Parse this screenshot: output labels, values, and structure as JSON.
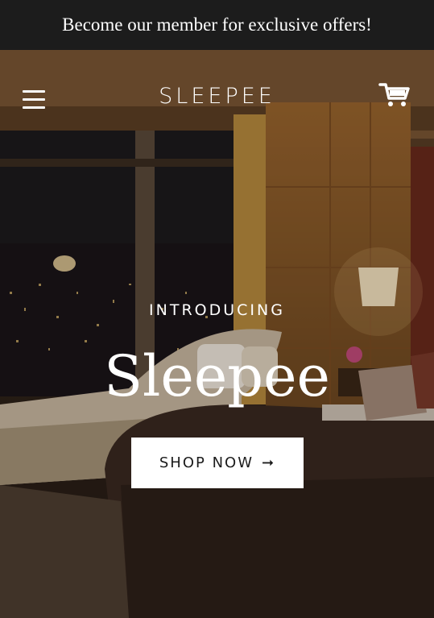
{
  "announcement": {
    "text": "Become our member for exclusive offers!"
  },
  "header": {
    "logo": "SLEEPEE",
    "menu_icon": "hamburger-menu-icon",
    "cart_icon": "shopping-cart-icon"
  },
  "hero": {
    "eyebrow": "INTRODUCING",
    "headline": "Sleepee",
    "cta_label": "SHOP NOW",
    "cta_icon": "arrow-right-icon",
    "cta_arrow": "➞"
  },
  "colors": {
    "announcement_bg": "#1c1c1c",
    "text_light": "#ffffff",
    "cta_bg": "#ffffff",
    "cta_text": "#1c1c1c"
  }
}
